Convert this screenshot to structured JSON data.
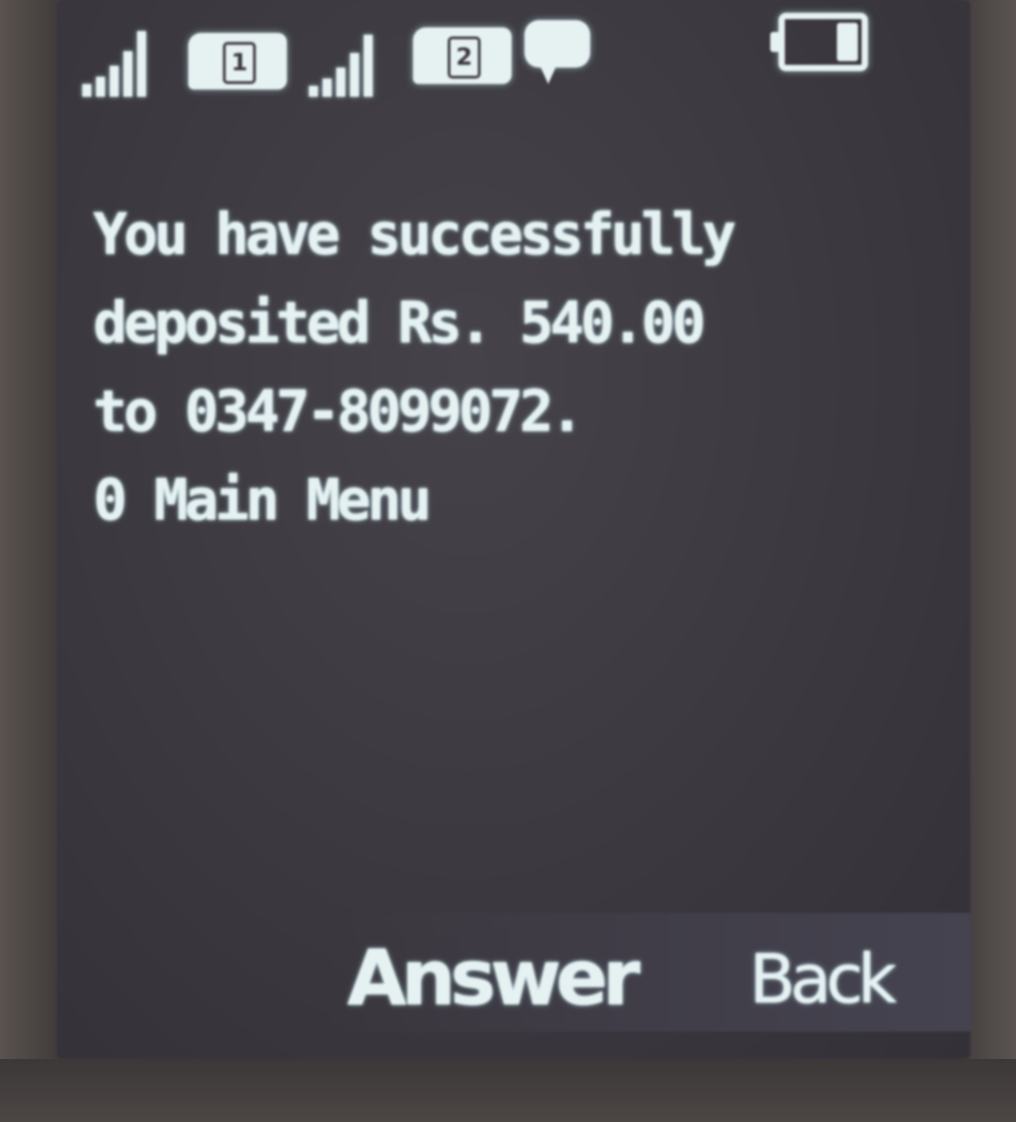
{
  "status_bar": {
    "sim1": {
      "label": "1",
      "signal_bars": 5
    },
    "sim2": {
      "label": "2",
      "signal_bars": 5
    },
    "unread_message_icon": "message-bubble-icon",
    "battery_level": 0.3
  },
  "message": {
    "lines": [
      "You have successfully",
      "deposited Rs. 540.00",
      "to 0347-8099072.",
      "0 Main Menu"
    ]
  },
  "softkeys": {
    "left": "Answer",
    "right": "Back"
  },
  "colors": {
    "lcd_text": "#e6f1f2",
    "screen_bg": "#3b383f"
  }
}
